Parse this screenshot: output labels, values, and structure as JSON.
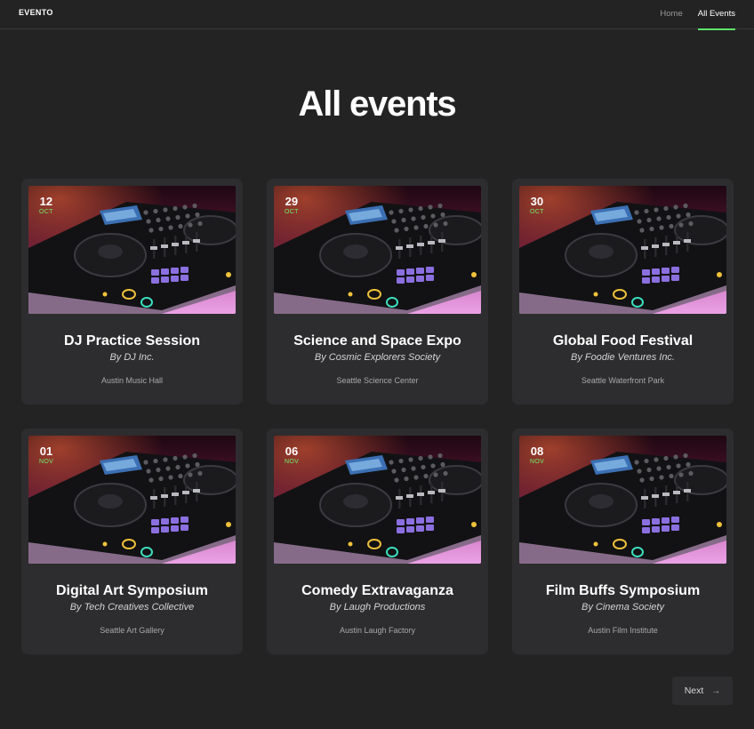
{
  "header": {
    "logo": "EVENTO",
    "nav": [
      {
        "label": "Home",
        "active": false
      },
      {
        "label": "All Events",
        "active": true
      }
    ]
  },
  "page": {
    "title": "All events"
  },
  "events": [
    {
      "day": "12",
      "month": "OCT",
      "title": "DJ Practice Session",
      "organizer": "By DJ Inc.",
      "venue": "Austin Music Hall"
    },
    {
      "day": "29",
      "month": "OCT",
      "title": "Science and Space Expo",
      "organizer": "By Cosmic Explorers Society",
      "venue": "Seattle Science Center"
    },
    {
      "day": "30",
      "month": "OCT",
      "title": "Global Food Festival",
      "organizer": "By Foodie Ventures Inc.",
      "venue": "Seattle Waterfront Park"
    },
    {
      "day": "01",
      "month": "NOV",
      "title": "Digital Art Symposium",
      "organizer": "By Tech Creatives Collective",
      "venue": "Seattle Art Gallery"
    },
    {
      "day": "06",
      "month": "NOV",
      "title": "Comedy Extravaganza",
      "organizer": "By Laugh Productions",
      "venue": "Austin Laugh Factory"
    },
    {
      "day": "08",
      "month": "NOV",
      "title": "Film Buffs Symposium",
      "organizer": "By Cinema Society",
      "venue": "Austin Film Institute"
    }
  ],
  "pagination": {
    "next_label": "Next",
    "next_icon": "arrow-right-icon"
  },
  "colors": {
    "background": "#232323",
    "card": "#2d2d2f",
    "accent_green": "#5ee36a"
  }
}
